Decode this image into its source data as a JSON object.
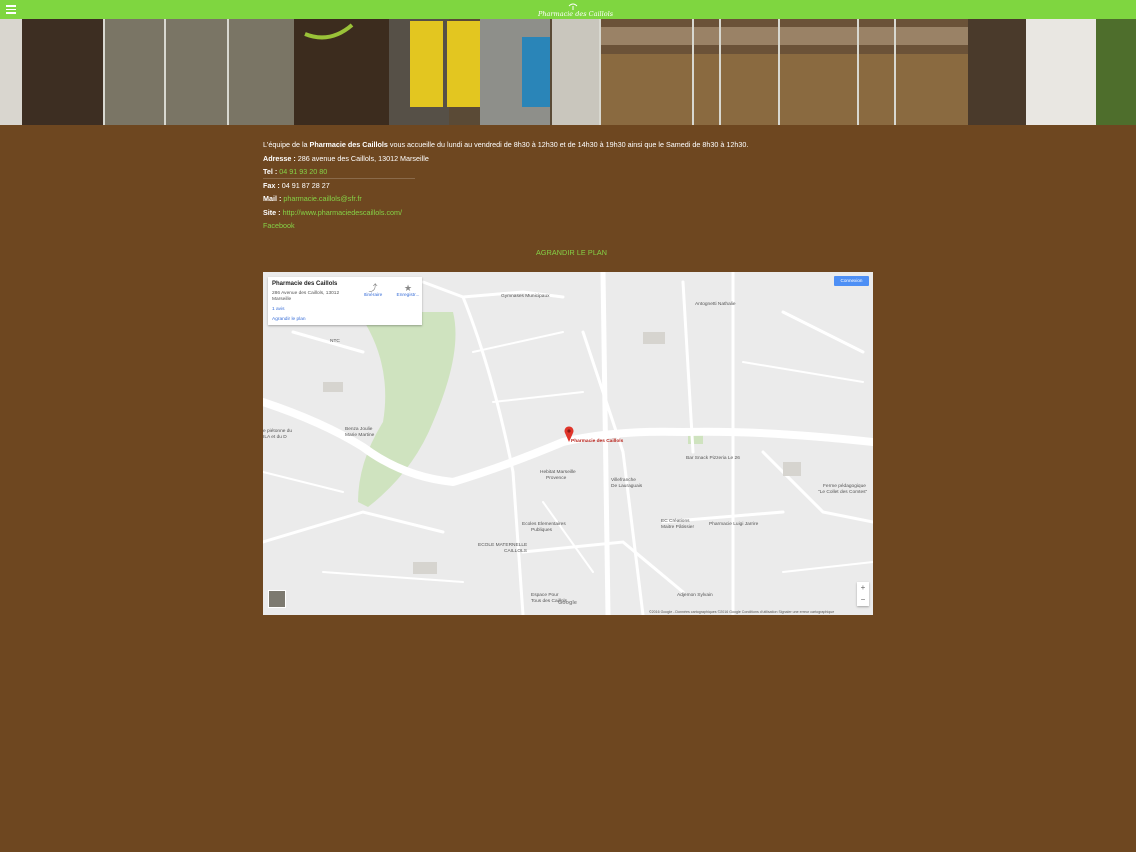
{
  "header": {
    "menu_icon": "hamburger-menu-icon",
    "logo_text": "Pharmacie des Caillols",
    "accent_color": "#7fd640"
  },
  "info": {
    "intro_prefix": "L'équipe de la ",
    "intro_name": "Pharmacie des Caillols",
    "intro_suffix": " vous accueille du lundi au vendredi de 8h30 à 12h30 et de 14h30 à 19h30 ainsi que le Samedi de 8h30 à 12h30.",
    "address_label": "Adresse :",
    "address_value": " 286 avenue des Caillols, 13012 Marseille",
    "tel_label": "Tel :",
    "tel_value": " 04 91 93 20 80",
    "fax_label": "Fax :",
    "fax_value": " 04 91 87 28 27",
    "mail_label": "Mail :",
    "mail_value": " pharmacie.caillols@sfr.fr",
    "site_label": "Site :",
    "site_value": " http://www.pharmaciedescaillols.com/",
    "facebook": "Facebook",
    "plan_link": "AGRANDIR LE PLAN"
  },
  "map": {
    "card": {
      "title": "Pharmacie des Caillols",
      "address": "286 Avenue des Caillols, 13012 Marseille",
      "reviews": "1 avis",
      "enlarge": "Agrandir le plan",
      "directions": "Itinéraire",
      "save": "Enregistr..."
    },
    "connexion": "Connexion",
    "pin_label": "Pharmacie des Caillols",
    "labels": {
      "gymnases": "Gymnases Municipaux",
      "antognetti": "Antognetti Nathalie",
      "ntc": "NTC",
      "benza": "Benza Joulie",
      "marie": "Marie Martine",
      "passerelle": "e piétonne du",
      "passerelle2": "ILA et du D",
      "hebitat": "Hebitat Marseille",
      "provence": "Provence",
      "villefranche": "Villefranche",
      "lauraguais": "De Lauraguais",
      "snack": "Bar Snack Pizzeria Le 26",
      "ferme": "Ferme pédagogique",
      "collet": "\"Le Collet des Comtes\"",
      "ecoles": "Ecoles Elementaires",
      "publiques": "Publiques",
      "maternelle": "ECOLE MATERNELLE",
      "caillols": "CAILLOLS",
      "ec": "EC Créations",
      "maitre": "Maitre Pâtissier",
      "luigi": "Pharmacie Luigi Jarrire",
      "adjemon": "Adjemon Sylvain",
      "espace": "Espace Pour",
      "tous": "Tous des Caillols"
    },
    "google": "Google",
    "zoom_in": "+",
    "zoom_out": "−",
    "footer": "©2016 Google - Données cartographiques ©2016 Google   Conditions d'utilisation   Signaler une erreur cartographique"
  }
}
